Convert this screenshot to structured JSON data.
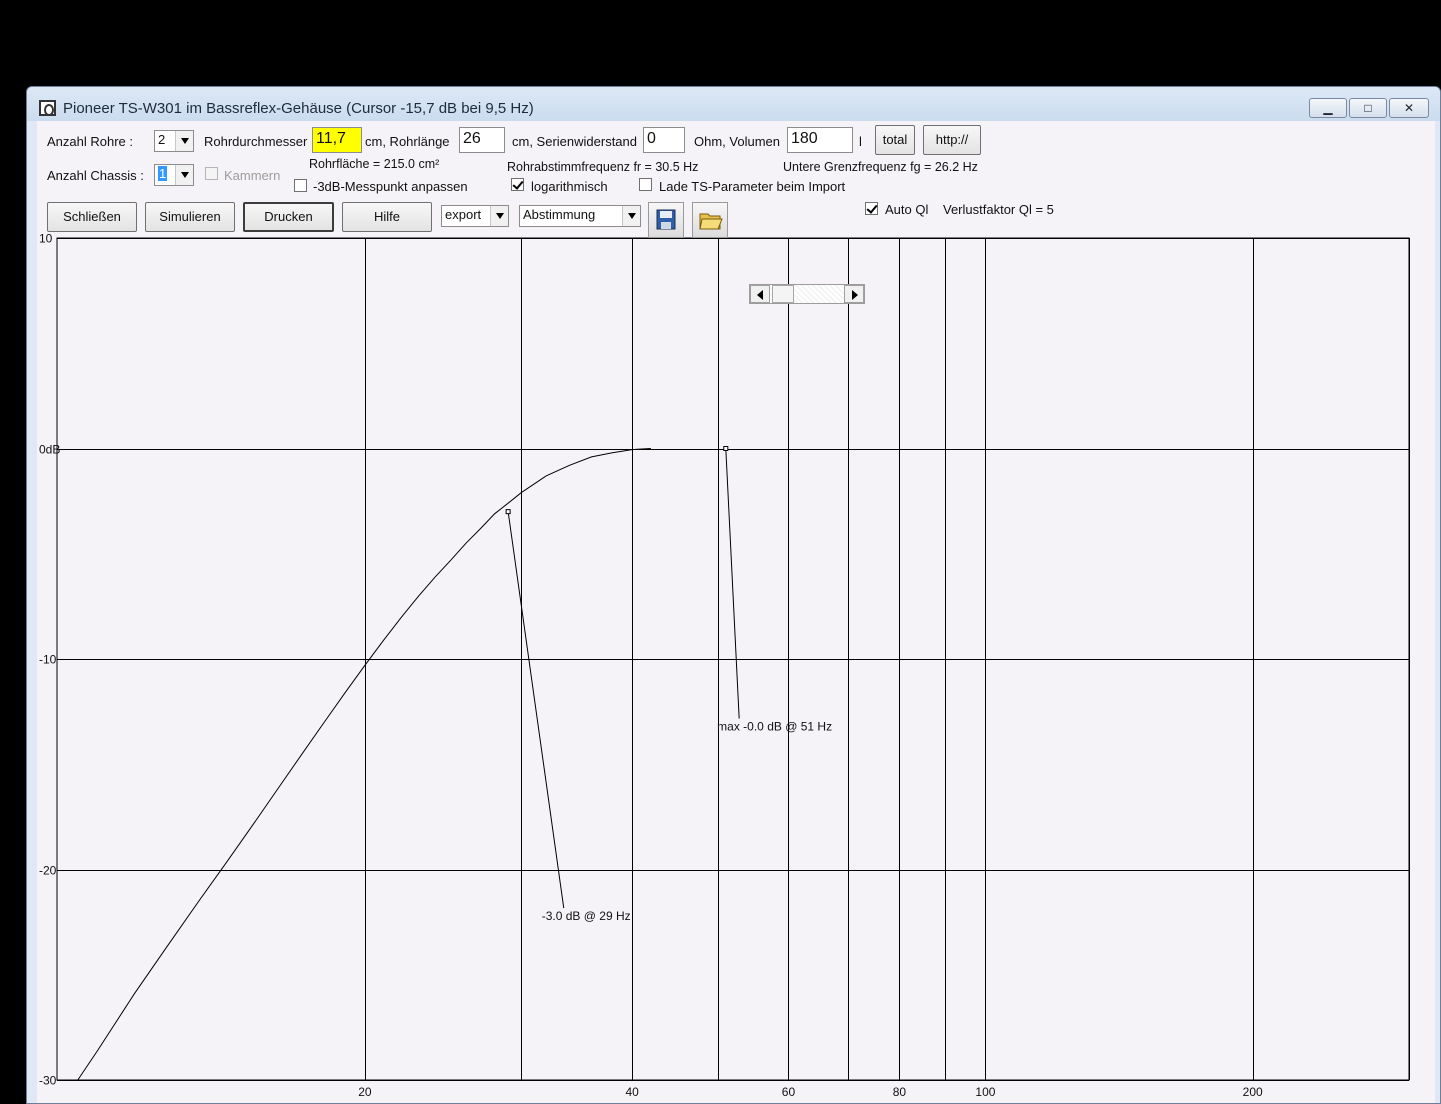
{
  "window": {
    "title": "Pioneer TS-W301 im Bassreflex-Gehäuse (Cursor -15,7 dB bei 9,5 Hz)",
    "minimize_glyph": "▁",
    "maximize_glyph": "□",
    "close_glyph": "✕"
  },
  "controls": {
    "anzahl_rohre_label": "Anzahl Rohre :",
    "anzahl_rohre_value": "2",
    "rohrdurchmesser_label": "Rohrdurchmesser",
    "rohrdurchmesser_value": "11,7",
    "rohrlaenge_label": "cm, Rohrlänge",
    "rohrlaenge_value": "26",
    "serienwiderstand_label": "cm, Serienwiderstand",
    "serienwiderstand_value": "0",
    "volumen_label": "Ohm, Volumen",
    "volumen_value": "180",
    "volumen_unit": "l",
    "total_button": "total",
    "http_button": "http://",
    "anzahl_chassis_label": "Anzahl Chassis :",
    "anzahl_chassis_value": "1",
    "kammern_label": "Kammern",
    "rohrflaeche_text": "Rohrfläche = 215.0 cm²",
    "messpunkt_label": "-3dB-Messpunkt anpassen",
    "abstimmfrequenz_text": "Rohrabstimmfrequenz fr = 30.5 Hz",
    "logarithmisch_label": "logarithmisch",
    "grenzfrequenz_text": "Untere Grenzfrequenz fg = 26.2 Hz",
    "lade_ts_label": "Lade TS-Parameter beim Import",
    "schliessen_button": "Schließen",
    "simulieren_button": "Simulieren",
    "drucken_button": "Drucken",
    "hilfe_button": "Hilfe",
    "export_value": "export",
    "abstimmung_value": "Abstimmung",
    "auto_ql_label": "Auto Ql",
    "verlustfaktor_text": "Verlustfaktor Ql = 5"
  },
  "checkbox_state": {
    "kammern": false,
    "messpunkt": false,
    "logarithmisch": true,
    "lade_ts": false,
    "auto_ql": true
  },
  "colors": {
    "highlight_field": "#ffff00",
    "plot_background": "#f5f3f7",
    "grid": "#000000"
  },
  "chart_data": {
    "type": "line",
    "x_scale": "log",
    "xlim": [
      9,
      300
    ],
    "ylim": [
      -30,
      10
    ],
    "x_tick_labels": [
      "20",
      "40",
      "60",
      "80",
      "100",
      "200"
    ],
    "x_gridlines": [
      20,
      30,
      40,
      50,
      60,
      70,
      80,
      90,
      100,
      200,
      300
    ],
    "y_ticks": [
      {
        "value": 10,
        "label": "10"
      },
      {
        "value": 0,
        "label": "0dB"
      },
      {
        "value": -10,
        "label": "-10"
      },
      {
        "value": -20,
        "label": "-20"
      },
      {
        "value": -30,
        "label": "-30"
      }
    ],
    "series": [
      {
        "x": [
          9.5,
          10,
          11,
          12,
          13,
          14,
          15,
          16,
          17,
          18,
          19,
          20,
          21,
          22,
          23,
          24,
          25,
          26,
          27,
          28,
          29,
          30,
          32,
          34,
          36,
          38,
          40,
          42
        ],
        "y": [
          -30,
          -28.6,
          -25.9,
          -23.6,
          -21.5,
          -19.6,
          -17.8,
          -16.1,
          -14.5,
          -13.0,
          -11.6,
          -10.3,
          -9.1,
          -8.0,
          -7.0,
          -6.1,
          -5.3,
          -4.5,
          -3.8,
          -3.1,
          -2.6,
          -2.1,
          -1.3,
          -0.8,
          -0.4,
          -0.2,
          -0.05,
          0
        ]
      }
    ],
    "markers": [
      {
        "x": 29,
        "y": -3.0,
        "label": "-3.0 dB @  29 Hz",
        "label_x": 33.5,
        "label_y": -22.4
      },
      {
        "x": 51,
        "y": 0,
        "label": "max -0.0 dB @ 51 Hz",
        "label_x": 52.8,
        "label_y": -13.4
      }
    ]
  }
}
